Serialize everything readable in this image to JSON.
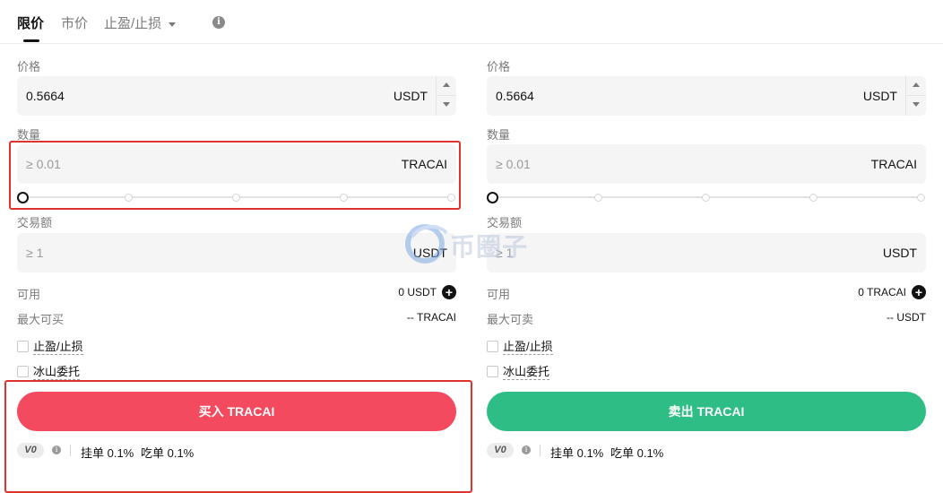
{
  "tabs": [
    {
      "label": "限价"
    },
    {
      "label": "市价"
    },
    {
      "label": "止盈/止损"
    }
  ],
  "buy": {
    "price_label": "价格",
    "price_value": "0.5664",
    "price_unit": "USDT",
    "amount_label": "数量",
    "amount_placeholder": "≥ 0.01",
    "amount_unit": "TRACAI",
    "slider_percent": 0,
    "total_label": "交易额",
    "total_placeholder": "≥ 1",
    "total_unit": "USDT",
    "available_label": "可用",
    "available_value": "0 USDT",
    "max_label": "最大可买",
    "max_value": "-- TRACAI",
    "tpsl_label": "止盈/止损",
    "iceberg_label": "冰山委托",
    "button_label": "买入 TRACAI",
    "button_color": "#f34a5f"
  },
  "sell": {
    "price_label": "价格",
    "price_value": "0.5664",
    "price_unit": "USDT",
    "amount_label": "数量",
    "amount_placeholder": "≥ 0.01",
    "amount_unit": "TRACAI",
    "slider_percent": 0,
    "total_label": "交易额",
    "total_placeholder": "≥ 1",
    "total_unit": "USDT",
    "available_label": "可用",
    "available_value": "0 TRACAI",
    "max_label": "最大可卖",
    "max_value": "-- USDT",
    "tpsl_label": "止盈/止损",
    "iceberg_label": "冰山委托",
    "button_label": "卖出 TRACAI",
    "button_color": "#2ebd85"
  },
  "fees": {
    "vip_level": "V0",
    "maker": "挂单 0.1%",
    "taker": "吃单 0.1%"
  },
  "watermark": {
    "text": "币圈子"
  },
  "colors": {
    "highlight": "#e0322c",
    "text_primary": "#121212",
    "text_secondary": "#7a7a7a"
  }
}
